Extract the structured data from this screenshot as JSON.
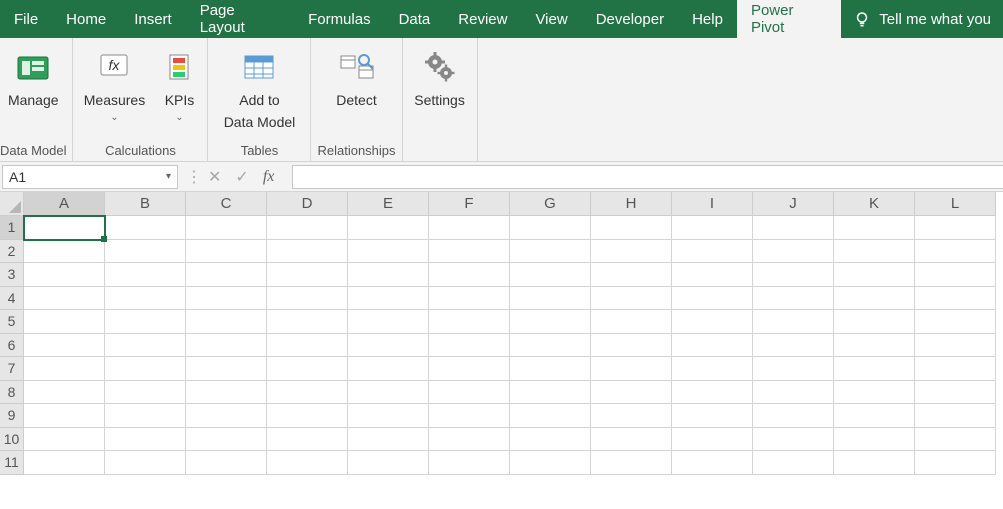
{
  "tabs": {
    "file": "File",
    "home": "Home",
    "insert": "Insert",
    "page_layout": "Page Layout",
    "formulas": "Formulas",
    "data": "Data",
    "review": "Review",
    "view": "View",
    "developer": "Developer",
    "help": "Help",
    "power_pivot": "Power Pivot",
    "tell_me": "Tell me what you"
  },
  "ribbon": {
    "manage": {
      "label": "Manage",
      "group": "Data Model"
    },
    "measures": {
      "label": "Measures"
    },
    "kpis": {
      "label": "KPIs"
    },
    "calculations_group": "Calculations",
    "add_to_data_model": {
      "line1": "Add to",
      "line2": "Data Model"
    },
    "tables_group": "Tables",
    "detect": {
      "label": "Detect"
    },
    "relationships_group": "Relationships",
    "settings": {
      "label": "Settings"
    }
  },
  "formula_bar": {
    "namebox": "A1"
  },
  "grid": {
    "columns": [
      "A",
      "B",
      "C",
      "D",
      "E",
      "F",
      "G",
      "H",
      "I",
      "J",
      "K",
      "L"
    ],
    "rows": [
      "1",
      "2",
      "3",
      "4",
      "5",
      "6",
      "7",
      "8",
      "9",
      "10",
      "11"
    ],
    "selected_cell": "A1",
    "selected_col": "A",
    "selected_row": "1"
  }
}
